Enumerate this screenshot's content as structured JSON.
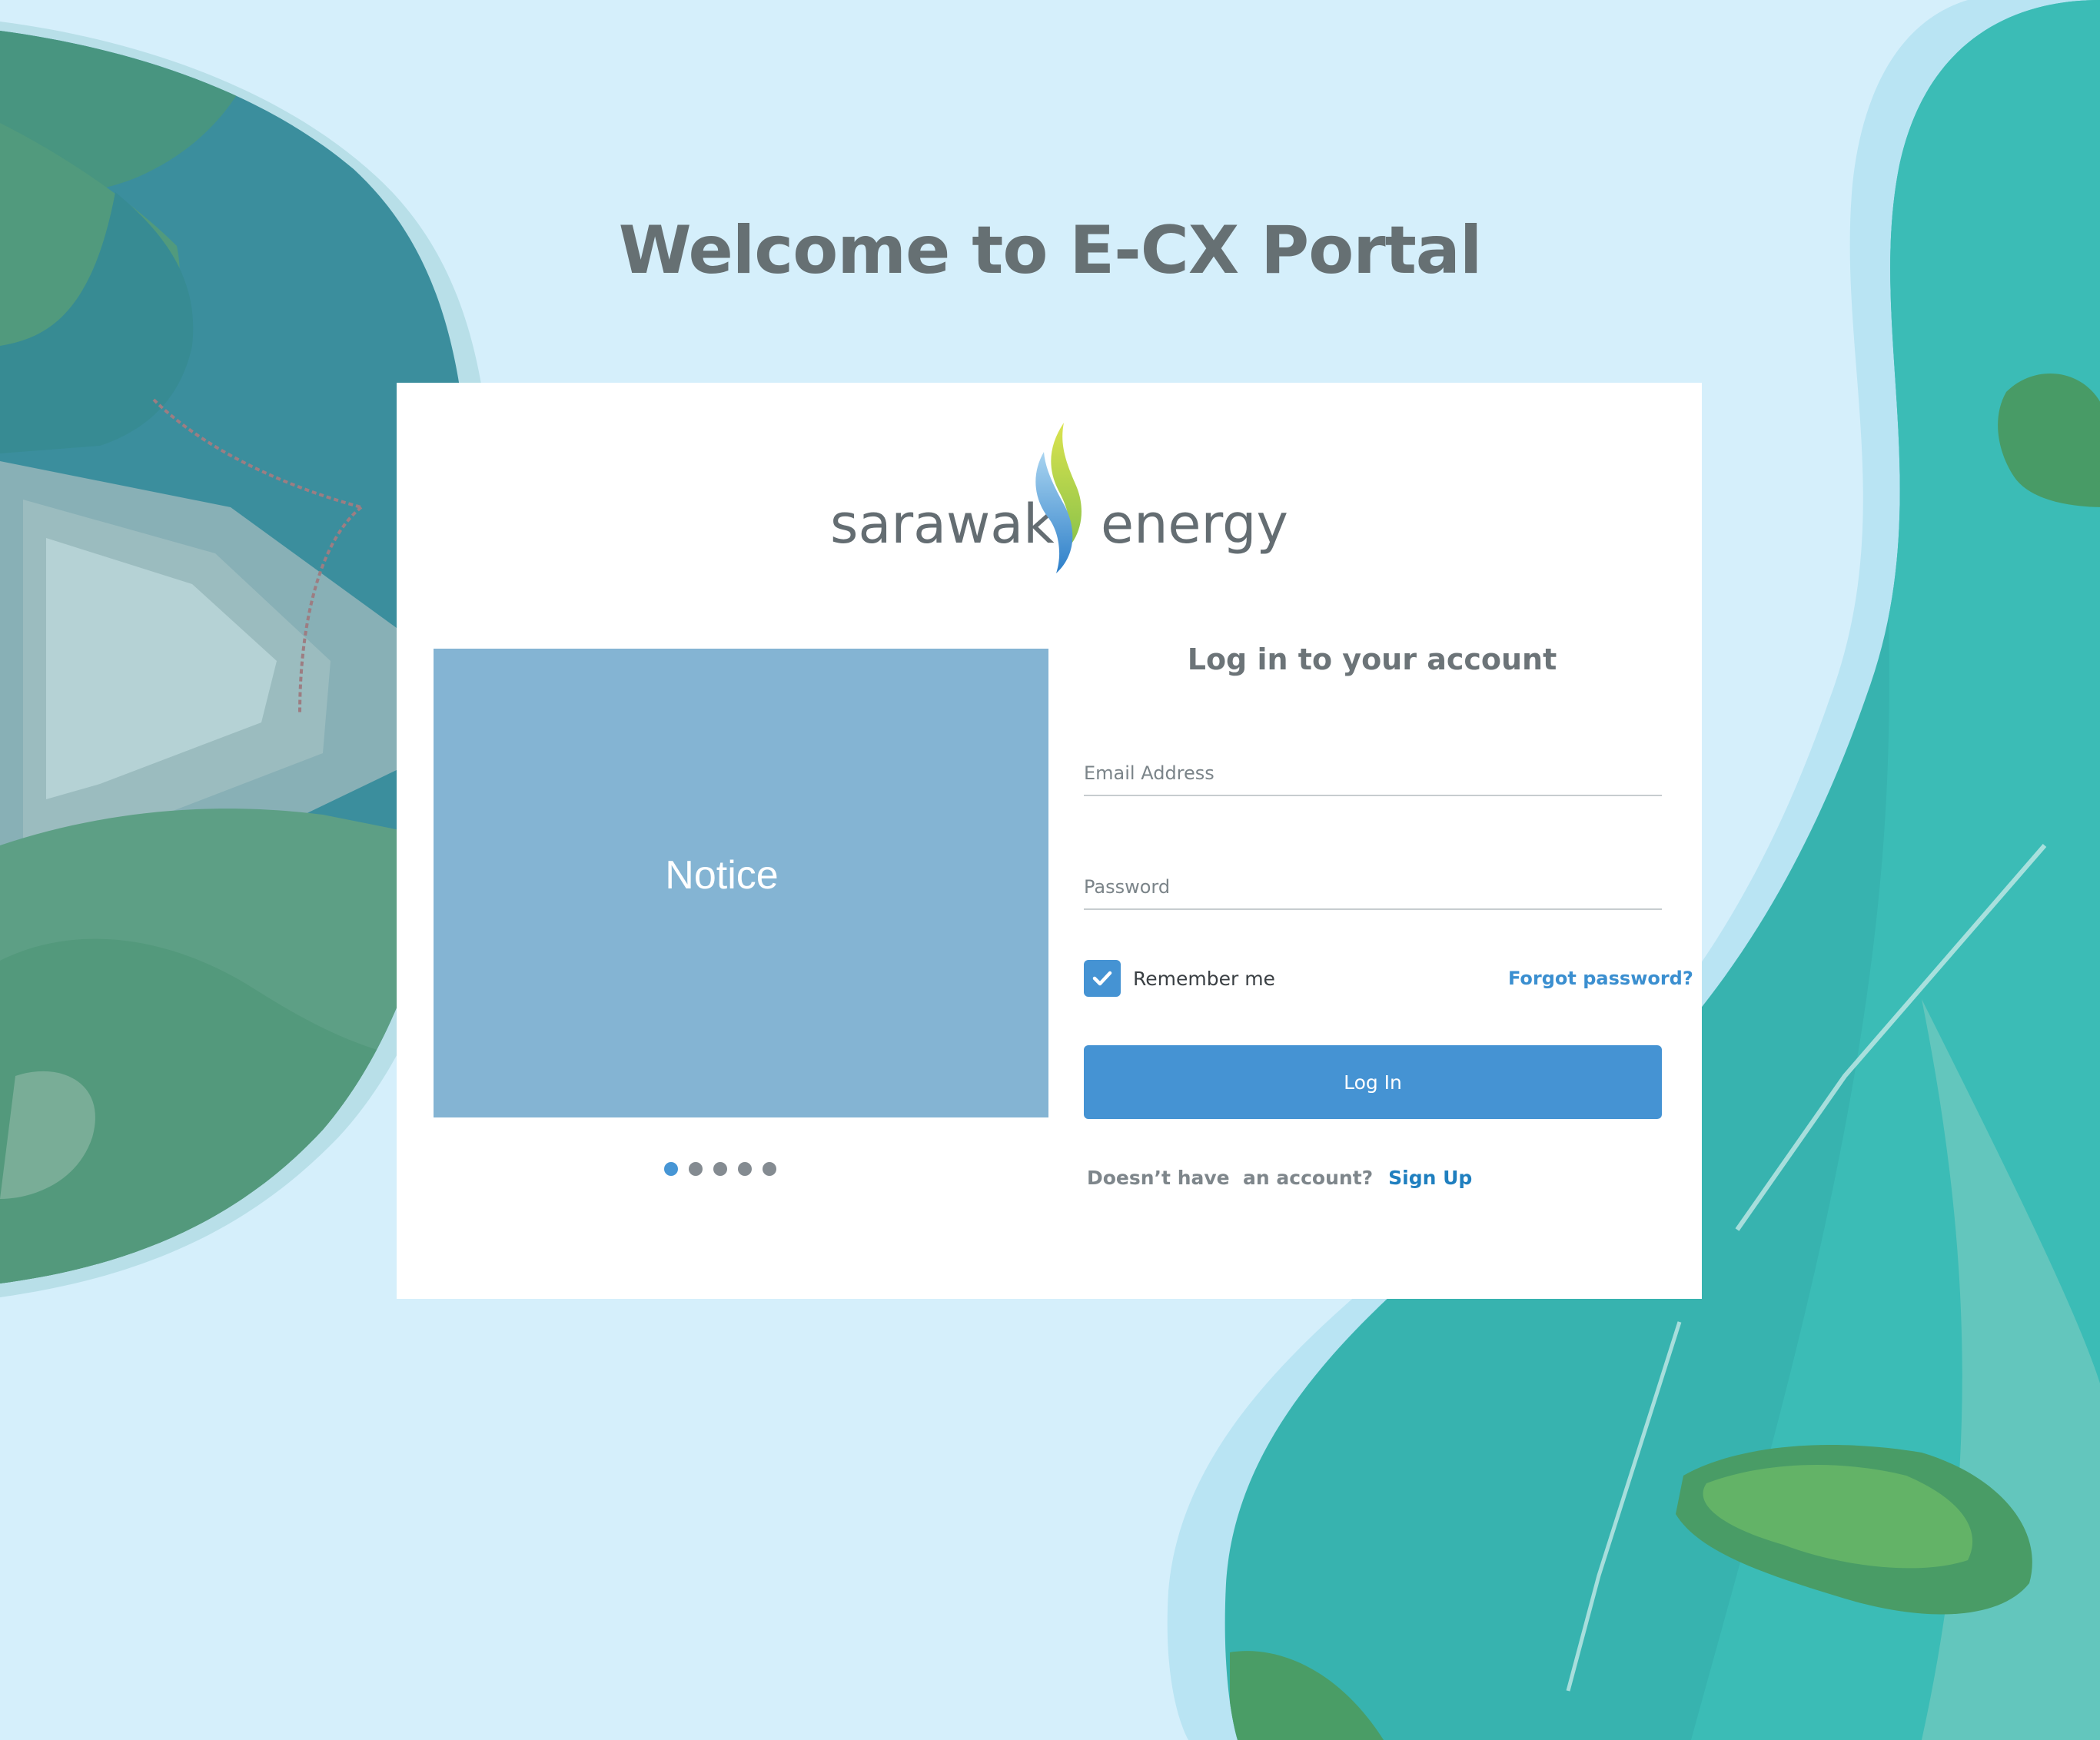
{
  "page": {
    "title": "Welcome to E-CX Portal"
  },
  "logo": {
    "text_left": "sarawak",
    "text_right": "energy"
  },
  "notice": {
    "label": "Notice",
    "slide_count": 5,
    "active_slide": 1
  },
  "login": {
    "heading": "Log in to your account",
    "email_placeholder": "Email Address",
    "email_value": "",
    "password_placeholder": "Password",
    "password_value": "",
    "remember_label": "Remember me",
    "remember_checked": true,
    "forgot_label": "Forgot password?",
    "button_label": "Log In",
    "signup_prompt": "Doesn’t have  an account?",
    "signup_link": "Sign Up"
  },
  "colors": {
    "background": "#d5effb",
    "accent": "#4593d3",
    "notice_panel": "#84b4d3",
    "title_text": "#667073",
    "signup_link": "#1f7fbf"
  }
}
